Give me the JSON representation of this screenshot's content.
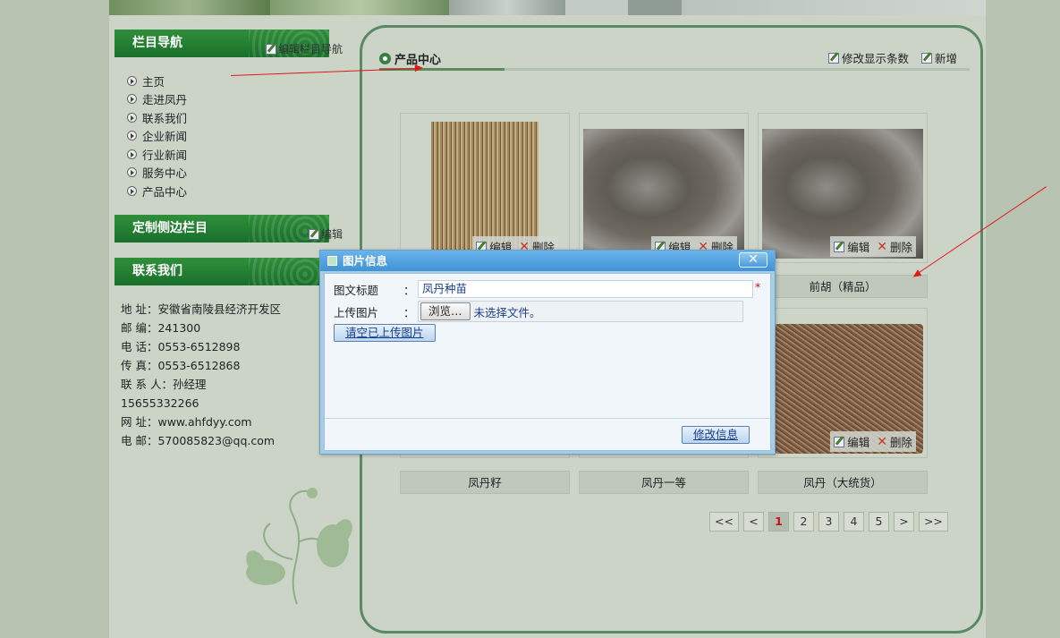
{
  "colors": {
    "sidebar_green": "#19702a",
    "panel_border": "#5a8a65",
    "dialog_blue": "#3f93d6",
    "arrow_red": "#e01818",
    "page_active": "#c0101a"
  },
  "sidebar": {
    "nav_title": "栏目导航",
    "nav_edit": "编辑栏目导航",
    "items": [
      "主页",
      "走进凤丹",
      "联系我们",
      "企业新闻",
      "行业新闻",
      "服务中心",
      "产品中心"
    ],
    "custom_title": "定制侧边栏目",
    "custom_edit": "编辑",
    "contact_title": "联系我们",
    "contact": [
      "地 址：安徽省南陵县经济开发区",
      "邮 编：241300",
      "电 话：0553-6512898",
      "传 真：0553-6512868",
      "联 系 人：孙经理",
      "15655332266",
      "网 址：www.ahfdyy.com",
      "电 邮：570085823@qq.com"
    ]
  },
  "main": {
    "title": "产品中心",
    "modify_count": "修改显示条数",
    "add": "新增",
    "edit_label": "编辑",
    "delete_label": "删除",
    "products": [
      {
        "caption": ""
      },
      {
        "caption": ""
      },
      {
        "caption": "前胡（精品）"
      },
      {
        "caption": "凤丹籽"
      },
      {
        "caption": "凤丹一等"
      },
      {
        "caption": "凤丹（大统货）"
      }
    ],
    "pager": [
      "<<",
      "<",
      "1",
      "2",
      "3",
      "4",
      "5",
      ">",
      ">>"
    ],
    "current_page": "1"
  },
  "dialog": {
    "title": "图片信息",
    "close": "✕",
    "title_label": "图文标题",
    "colon": "：",
    "title_value": "凤丹种苗",
    "required_mark": "*",
    "upload_label": "上传图片",
    "browse": "浏览…",
    "file_status": "未选择文件。",
    "clear_upload": "请空已上传图片",
    "submit": "修改信息"
  }
}
